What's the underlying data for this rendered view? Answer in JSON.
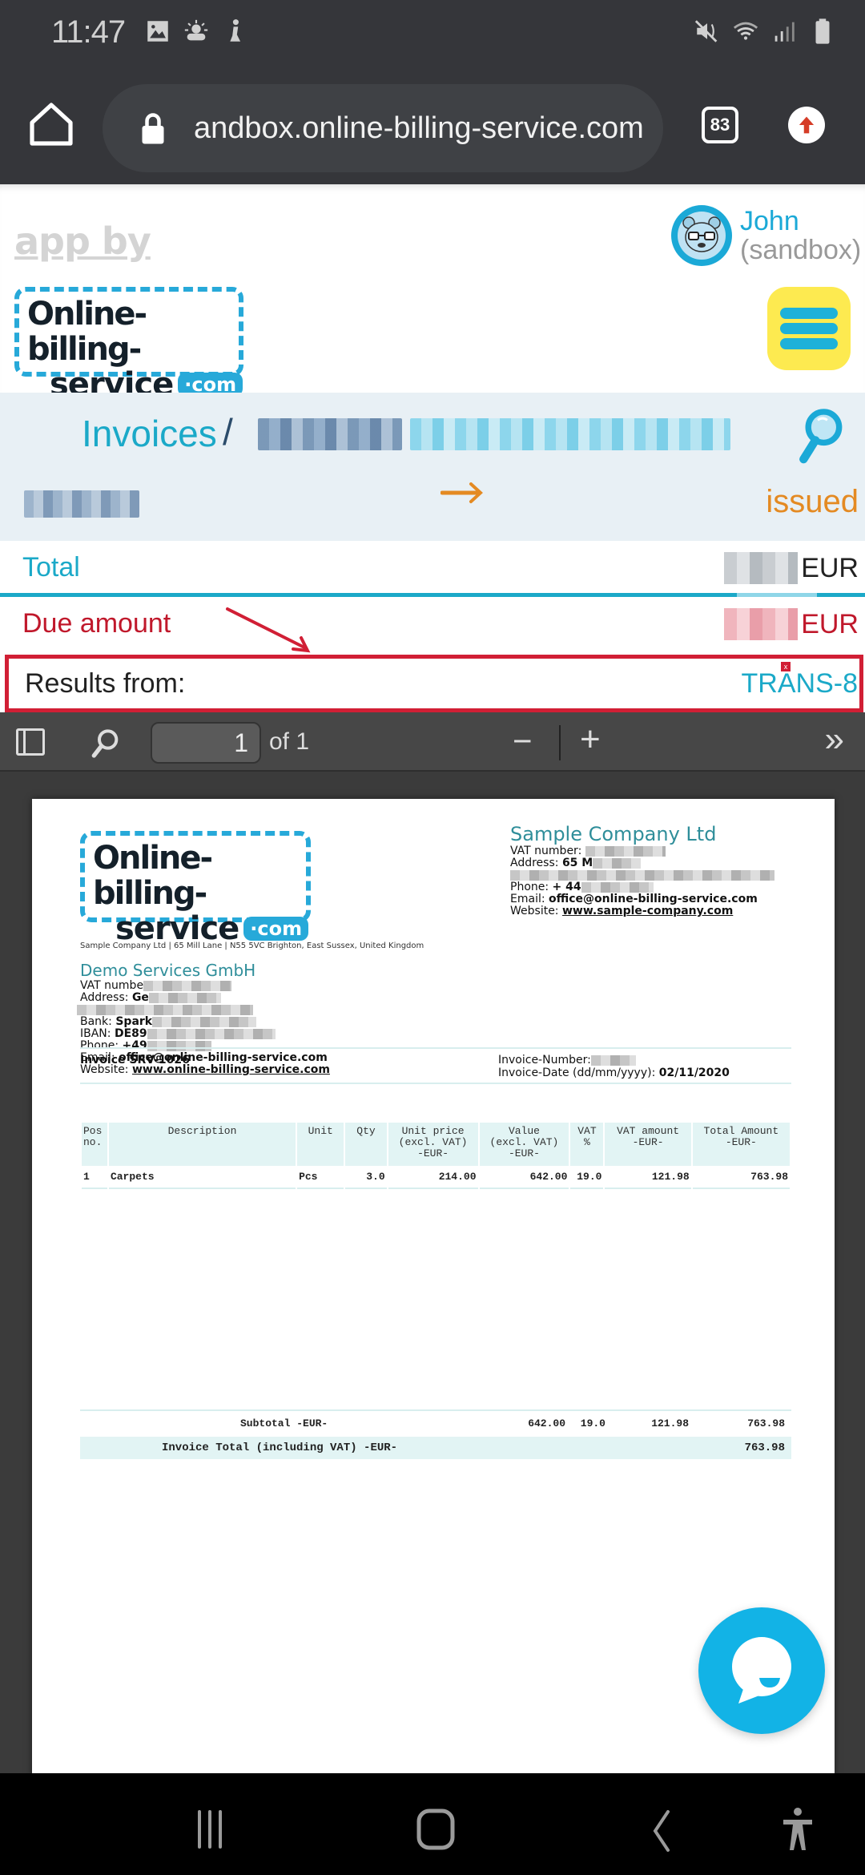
{
  "status_bar": {
    "time": "11:47",
    "left_icons": [
      "gallery-icon",
      "weather-icon",
      "accessibility-notification-icon"
    ],
    "right_icons": [
      "mute-icon",
      "wifi-icon",
      "signal-icon",
      "battery-icon"
    ]
  },
  "browser": {
    "url": "andbox.online-billing-service.com",
    "tab_count": "83"
  },
  "app_header": {
    "app_by": "app by",
    "logo_line1": "Online-billing-",
    "logo_line2": "service",
    "logo_com": "·com",
    "user_name": "John",
    "user_sub": "(sandbox)"
  },
  "breadcrumb": {
    "root": "Invoices",
    "separator": "/",
    "status": "issued"
  },
  "summary": {
    "total_label": "Total",
    "total_currency": "EUR",
    "due_label": "Due amount",
    "due_currency": "EUR",
    "results_label": "Results from:",
    "results_link": "TRANS-8",
    "results_remove": "x"
  },
  "pdf_toolbar": {
    "page_current": "1",
    "page_of": "of 1",
    "zoom_out": "−",
    "zoom_in": "+",
    "more": "»"
  },
  "invoice": {
    "logo_line1": "Online-billing-",
    "logo_line2": "service",
    "logo_com": "·com",
    "company": {
      "name": "Sample Company Ltd",
      "vat_label": "VAT number:",
      "address_label": "Address:",
      "address_partial": "65 M",
      "phone_label": "Phone:",
      "phone_partial": "+ 44",
      "email_label": "Email:",
      "email": "office@online-billing-service.com",
      "website_label": "Website:",
      "website": "www.sample-company.com"
    },
    "sender_line": "Sample Company Ltd | 65 Mill Lane  | N55 5VC Brighton, East Sussex, United Kingdom",
    "client": {
      "name": "Demo Services GmbH",
      "vat_label": "VAT numbe",
      "address_label": "Address:",
      "address_partial": "Ge",
      "bank_label": "Bank:",
      "bank_partial": "Spark",
      "iban_label": "IBAN:",
      "iban_partial": "DE89",
      "phone_label": "Phone:",
      "phone_partial": "+49",
      "email_label": "Email:",
      "email": "office@online-billing-service.com",
      "website_label": "Website:",
      "website": "www.online-billing-service.com"
    },
    "title": "Invoice SRV-1026",
    "number_label": "Invoice-Number:",
    "date_label": "Invoice-Date (dd/mm/yyyy):",
    "date": "02/11/2020",
    "table": {
      "headers": [
        "Pos no.",
        "Description",
        "Unit",
        "Qty",
        "Unit price (excl. VAT) -EUR-",
        "Value (excl. VAT) -EUR-",
        "VAT %",
        "VAT amount -EUR-",
        "Total Amount -EUR-"
      ],
      "header_lines": [
        [
          "Pos",
          "no."
        ],
        [
          "Description"
        ],
        [
          "Unit"
        ],
        [
          "Qty"
        ],
        [
          "Unit price",
          "(excl. VAT)",
          "-EUR-"
        ],
        [
          "Value",
          "(excl. VAT)",
          "-EUR-"
        ],
        [
          "VAT",
          "%"
        ],
        [
          "VAT amount",
          "-EUR-"
        ],
        [
          "Total Amount",
          "-EUR-"
        ]
      ],
      "rows": [
        [
          "1",
          "Carpets",
          "Pcs",
          "3.0",
          "214.00",
          "642.00",
          "19.0",
          "121.98",
          "763.98"
        ]
      ]
    },
    "subtotal": {
      "label": "Subtotal -EUR-",
      "value": "642.00",
      "vat_pct": "19.0",
      "vat_amount": "121.98",
      "total": "763.98"
    },
    "grand_total": {
      "label": "Invoice Total (including VAT) -EUR-",
      "value": "763.98"
    }
  },
  "colors": {
    "accent": "#1ba9c8",
    "danger": "#d11f35",
    "status_orange": "#e48a22",
    "menu_yellow": "#fdea50"
  }
}
